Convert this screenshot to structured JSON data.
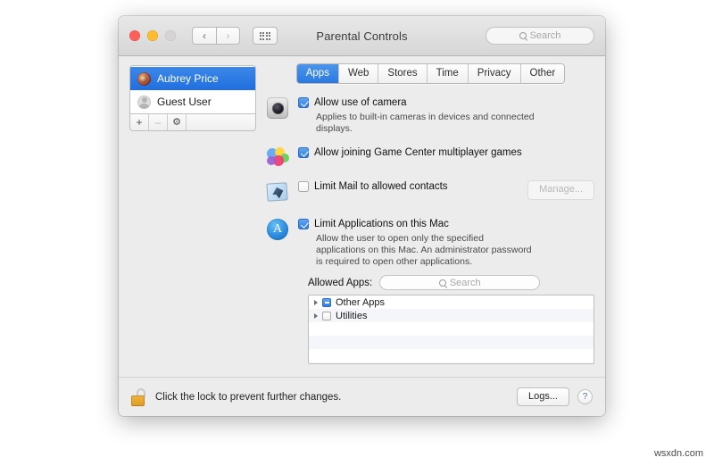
{
  "window": {
    "title": "Parental Controls",
    "traffic_lights": [
      "close",
      "minimize",
      "zoom"
    ],
    "nav": {
      "back": "‹",
      "forward": "›"
    },
    "search": {
      "placeholder": "Search",
      "value": ""
    }
  },
  "sidebar": {
    "users": [
      {
        "name": "Aubrey Price",
        "selected": true,
        "avatar": "photo-avatar"
      },
      {
        "name": "Guest User",
        "selected": false,
        "avatar": "guest-avatar"
      }
    ],
    "footer_buttons": [
      {
        "name": "add",
        "label": "+"
      },
      {
        "name": "remove",
        "label": "–"
      },
      {
        "name": "settings",
        "label": "⚙"
      }
    ]
  },
  "tabs": [
    {
      "label": "Apps",
      "active": true
    },
    {
      "label": "Web",
      "active": false
    },
    {
      "label": "Stores",
      "active": false
    },
    {
      "label": "Time",
      "active": false
    },
    {
      "label": "Privacy",
      "active": false
    },
    {
      "label": "Other",
      "active": false
    }
  ],
  "options": {
    "camera": {
      "label": "Allow use of camera",
      "description": "Applies to built-in cameras in devices and connected displays.",
      "checked": true,
      "icon": "camera-icon"
    },
    "game_center": {
      "label": "Allow joining Game Center multiplayer games",
      "checked": true,
      "icon": "game-center-icon"
    },
    "mail": {
      "label": "Limit Mail to allowed contacts",
      "checked": false,
      "icon": "mail-icon",
      "button": {
        "label": "Manage...",
        "disabled": true
      }
    },
    "limit_apps": {
      "label": "Limit Applications on this Mac",
      "description": "Allow the user to open only the specified applications on this Mac. An administrator password is required to open other applications.",
      "checked": true,
      "icon": "app-store-icon"
    }
  },
  "allowed_apps": {
    "label": "Allowed Apps:",
    "search": {
      "placeholder": "Search",
      "value": ""
    },
    "items": [
      {
        "name": "Other Apps",
        "state": "mixed",
        "expandable": true
      },
      {
        "name": "Utilities",
        "state": "unchecked",
        "expandable": true
      }
    ],
    "empty_rows": 4
  },
  "footer": {
    "lock_text": "Click the lock to prevent further changes.",
    "lock_state": "unlocked",
    "logs_button": "Logs...",
    "help_button": "?"
  },
  "watermark": "wsxdn.com",
  "colors": {
    "accent": "#2a79e2",
    "selection": "#1f6fdf",
    "lock": "#dd9a22",
    "window_bg": "#ececec"
  }
}
